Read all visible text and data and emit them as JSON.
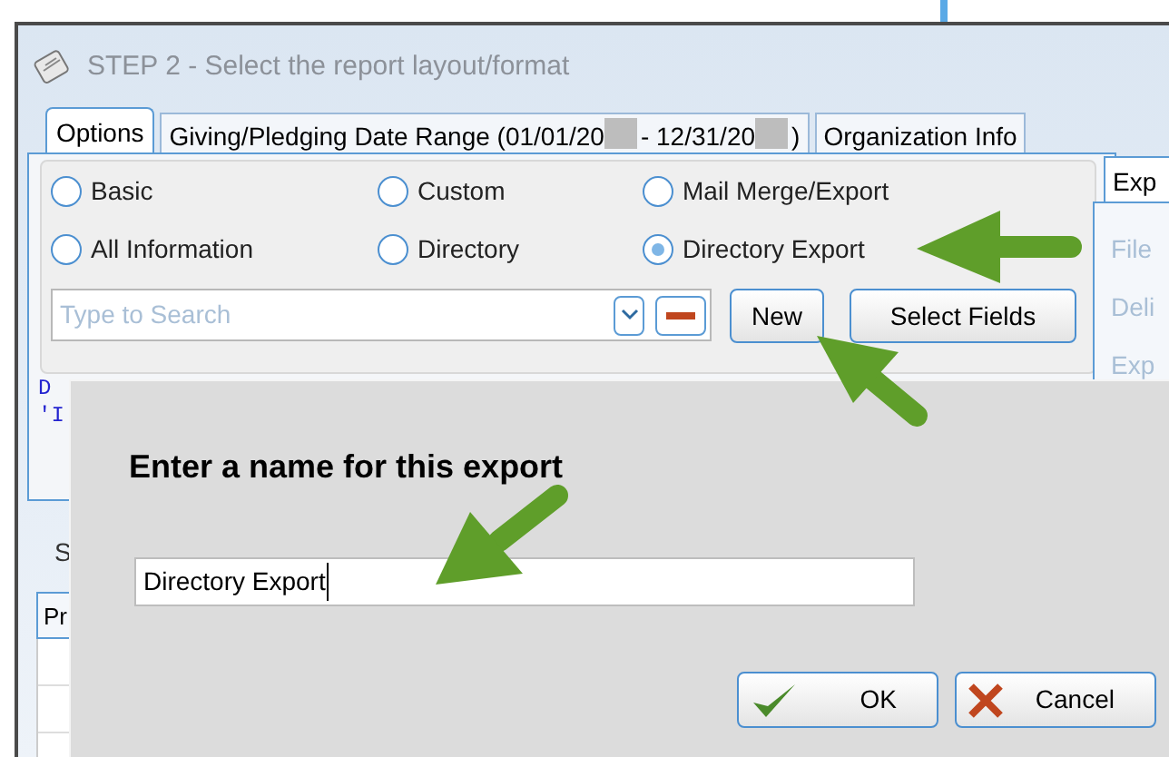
{
  "window": {
    "title": "STEP 2 - Select the report layout/format"
  },
  "tabs": [
    {
      "segments": [
        "Options"
      ],
      "selected": true
    },
    {
      "segments": [
        "Giving/Pledging Date Range (01/01/20",
        "- 12/31/20",
        ")"
      ],
      "selected": false
    },
    {
      "segments": [
        "Organization Info"
      ],
      "selected": false
    }
  ],
  "report_types": [
    {
      "label": "Basic",
      "selected": false
    },
    {
      "label": "Custom",
      "selected": false
    },
    {
      "label": "Mail Merge/Export",
      "selected": false
    },
    {
      "label": "All Information",
      "selected": false
    },
    {
      "label": "Directory",
      "selected": false
    },
    {
      "label": "Directory Export",
      "selected": true
    }
  ],
  "search": {
    "placeholder": "Type to Search"
  },
  "buttons": [
    "New",
    "Select Fields"
  ],
  "query_text": [
    "D",
    "'I"
  ],
  "right_panel": {
    "tab": "Exp",
    "labels": [
      "File",
      "Deli",
      "Exp"
    ]
  },
  "lower_panel": {
    "label": "S",
    "tab": "Pr"
  },
  "dialog": {
    "prompt": "Enter a name for this export",
    "value": "Directory Export",
    "buttons": [
      {
        "label": "OK",
        "kind": "ok"
      },
      {
        "label": "Cancel",
        "kind": "cancel"
      }
    ]
  }
}
